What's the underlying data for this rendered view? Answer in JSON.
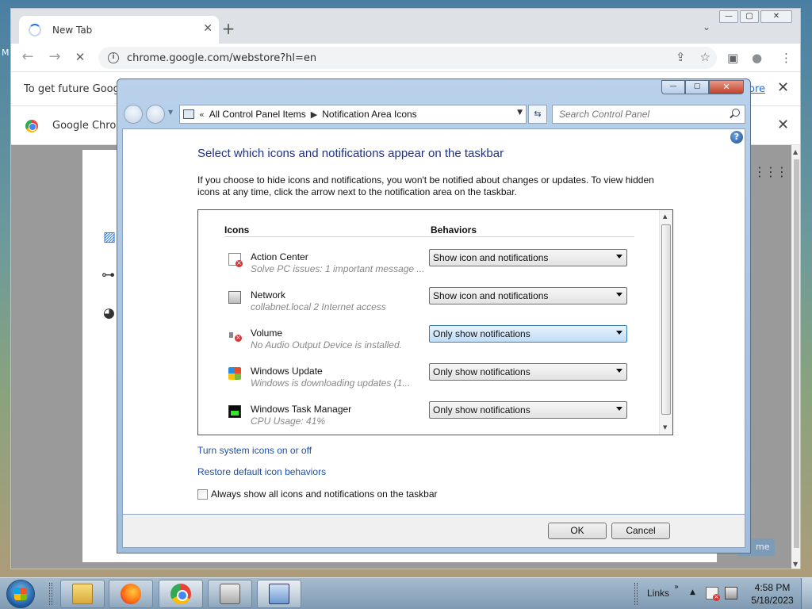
{
  "desktop": {
    "edge_label": "M"
  },
  "chrome": {
    "tab_title": "New Tab",
    "tab_close": "✕",
    "new_tab": "+",
    "tab_search": "⌄",
    "window_controls": {
      "minimize": "—",
      "maximize": "▢",
      "close": "✕"
    },
    "nav": {
      "back": "←",
      "forward": "→",
      "reload": "✕"
    },
    "url": "chrome.google.com/webstore?hl=en",
    "omnibox_icons": {
      "share": "⇪",
      "bookmark": "☆"
    },
    "toolbar_icons": {
      "sidepanel": "▣",
      "profile": "●",
      "menu": "⋮"
    },
    "infobar_text": "To get future Google",
    "infobar_link": "ore",
    "infobar_close": "✕",
    "bookmark_text": "Google Chrom",
    "bookmark_close": "✕",
    "side_icons": {
      "image": "▨",
      "link": "⊶",
      "palette": "◕"
    },
    "apps_grid": "⋮⋮⋮",
    "chip_text": "me"
  },
  "dialog": {
    "controls": {
      "minimize": "—",
      "maximize": "▢",
      "close": "✕"
    },
    "breadcrumb": {
      "prefix": "«",
      "parent": "All Control Panel Items",
      "separator": "▶",
      "current": "Notification Area Icons"
    },
    "search_placeholder": "Search Control Panel",
    "help": "?",
    "title": "Select which icons and notifications appear on the taskbar",
    "description": "If you choose to hide icons and notifications, you won't be notified about changes or updates. To view hidden icons at any time, click the arrow next to the notification area on the taskbar.",
    "columns": {
      "icons": "Icons",
      "behaviors": "Behaviors"
    },
    "rows": [
      {
        "name": "Action Center",
        "desc": "Solve PC issues: 1 important message ...",
        "behavior": "Show icon and notifications",
        "icon": "action-center-icon"
      },
      {
        "name": "Network",
        "desc": "collabnet.local  2 Internet access",
        "behavior": "Show icon and notifications",
        "icon": "network-icon"
      },
      {
        "name": "Volume",
        "desc": "No Audio Output Device is installed.",
        "behavior": "Only show notifications",
        "icon": "volume-icon"
      },
      {
        "name": "Windows Update",
        "desc": "Windows is downloading updates (1...",
        "behavior": "Only show notifications",
        "icon": "windows-update-icon"
      },
      {
        "name": "Windows Task Manager",
        "desc": "CPU Usage: 41%",
        "behavior": "Only show notifications",
        "icon": "task-manager-icon"
      }
    ],
    "link_system_icons": "Turn system icons on or off",
    "link_restore": "Restore default icon behaviors",
    "checkbox_label": "Always show all icons and notifications on the taskbar",
    "checkbox_checked": false,
    "ok": "OK",
    "cancel": "Cancel"
  },
  "taskbar": {
    "links": "Links",
    "links_chevron": "»",
    "tray_up": "▲",
    "time": "4:58 PM",
    "date": "5/18/2023"
  }
}
